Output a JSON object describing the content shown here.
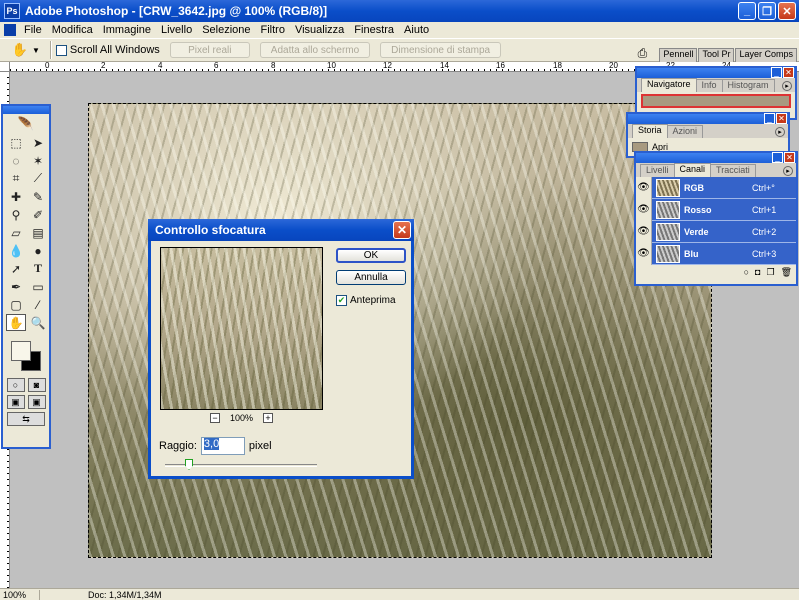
{
  "window": {
    "title": "Adobe Photoshop - [CRW_3642.jpg @ 100% (RGB/8)]",
    "logo_text": "Ps"
  },
  "menu": [
    "File",
    "Modifica",
    "Immagine",
    "Livello",
    "Selezione",
    "Filtro",
    "Visualizza",
    "Finestra",
    "Aiuto"
  ],
  "options": {
    "scroll_all_label": "Scroll All Windows",
    "scroll_all_checked": false,
    "buttons": [
      "Pixel reali",
      "Adatta allo schermo",
      "Dimensione di stampa"
    ],
    "well_tabs": [
      "Pennell",
      "Tool Pr",
      "Layer Comps"
    ]
  },
  "ruler": {
    "h_labels": [
      "0",
      "2",
      "4",
      "6",
      "8",
      "10",
      "12",
      "14",
      "16",
      "18",
      "20",
      "22",
      "24"
    ]
  },
  "toolbox": {
    "tools": [
      "marquee-tool",
      "move-tool",
      "lasso-tool",
      "magic-wand-tool",
      "crop-tool",
      "slice-tool",
      "healing-brush-tool",
      "brush-tool",
      "clone-stamp-tool",
      "history-brush-tool",
      "eraser-tool",
      "gradient-tool",
      "blur-tool",
      "dodge-tool",
      "path-selection-tool",
      "type-tool",
      "pen-tool",
      "shape-tool",
      "notes-tool",
      "eyedropper-tool",
      "hand-tool",
      "zoom-tool"
    ],
    "active_tool": "hand-tool",
    "foreground_color": "#f8f6ea",
    "background_color": "#000000"
  },
  "navigator": {
    "tabs": [
      "Navigatore",
      "Info",
      "Histogram"
    ],
    "active": "Navigatore"
  },
  "history": {
    "tabs": [
      "Storia",
      "Azioni"
    ],
    "active": "Storia",
    "items": [
      "Apri"
    ]
  },
  "channels": {
    "tabs": [
      "Livelli",
      "Canali",
      "Tracciati"
    ],
    "active": "Canali",
    "rows": [
      {
        "name": "RGB",
        "shortcut": "Ctrl+°"
      },
      {
        "name": "Rosso",
        "shortcut": "Ctrl+1"
      },
      {
        "name": "Verde",
        "shortcut": "Ctrl+2"
      },
      {
        "name": "Blu",
        "shortcut": "Ctrl+3"
      }
    ]
  },
  "dialog": {
    "title": "Controllo sfocatura",
    "ok_label": "OK",
    "cancel_label": "Annulla",
    "preview_label": "Anteprima",
    "preview_checked": true,
    "zoom_minus": "−",
    "zoom_value": "100%",
    "zoom_plus": "+",
    "radius_label": "Raggio:",
    "radius_value": "3,0",
    "radius_unit": "pixel"
  },
  "status": {
    "zoom": "100%",
    "doc": "Doc: 1,34M/1,34M"
  },
  "colors": {
    "accent": "#0a4ec9",
    "selection": "#3563c9"
  }
}
